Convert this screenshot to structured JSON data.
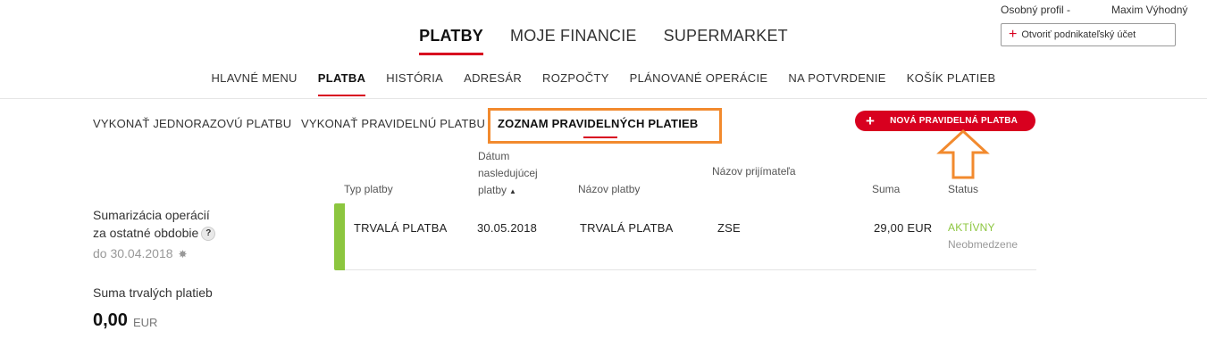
{
  "profile": {
    "label": "Osobný profil  -",
    "name": "Maxim Výhodný",
    "business_button": "Otvoriť podnikateľský účet"
  },
  "main_nav": [
    "PLATBY",
    "MOJE FINANCIE",
    "SUPERMARKET"
  ],
  "main_nav_active": "PLATBY",
  "sub_nav": [
    "HLAVNÉ MENU",
    "PLATBA",
    "HISTÓRIA",
    "ADRESÁR",
    "ROZPOČTY",
    "PLÁNOVANÉ OPERÁCIE",
    "NA POTVRDENIE",
    "KOŠÍK PLATIEB"
  ],
  "sub_nav_active": "PLATBA",
  "tabs": [
    "VYKONAŤ JEDNORAZOVÚ PLATBU",
    "VYKONAŤ PRAVIDELNÚ PLATBU",
    "ZOZNAM PRAVIDELNÝCH PLATIEB"
  ],
  "new_button": "NOVÁ PRAVIDELNÁ PLATBA",
  "table": {
    "headers": {
      "type": "Typ platby",
      "date_line1": "Dátum",
      "date_line2": "nasledujúcej",
      "date_line3": "platby",
      "name": "Názov platby",
      "recipient": "Názov prijímateľa",
      "sum": "Suma",
      "status": "Status"
    },
    "rows": [
      {
        "type": "TRVALÁ PLATBA",
        "date": "30.05.2018",
        "name": "TRVALÁ PLATBA",
        "recipient": "ZSE",
        "sum": "29,00 EUR",
        "status": "AKTÍVNY",
        "status_detail": "Neobmedzene"
      }
    ]
  },
  "summary": {
    "title_line1": "Sumarizácia operácií",
    "title_line2": "za ostatné obdobie",
    "period": "do 30.04.2018",
    "standing_label": "Suma trvalých platieb",
    "total_value": "0,00",
    "total_currency": "EUR"
  },
  "colors": {
    "accent": "#d8001f",
    "status_active": "#8cc63f",
    "highlight": "#f28a2e"
  }
}
